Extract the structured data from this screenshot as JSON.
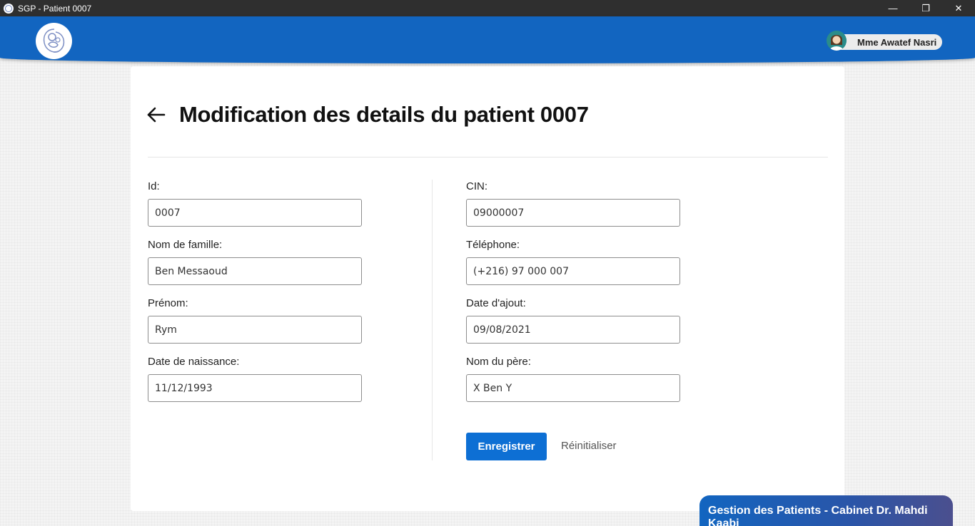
{
  "window": {
    "title": "SGP - Patient 0007",
    "minimize_glyph": "—",
    "restore_glyph": "❐",
    "close_glyph": "✕"
  },
  "header": {
    "user_name": "Mme Awatef Nasri",
    "logo_icon": "mother-child-logo-icon",
    "avatar_icon": "user-avatar-icon"
  },
  "page": {
    "title": "Modification des details du patient 0007",
    "back_icon": "arrow-left-icon"
  },
  "form": {
    "left": [
      {
        "label": "Id:",
        "value": "0007"
      },
      {
        "label": "Nom de famille:",
        "value": "Ben Messaoud"
      },
      {
        "label": "Prénom:",
        "value": "Rym"
      },
      {
        "label": "Date de naissance:",
        "value": "11/12/1993"
      }
    ],
    "right": [
      {
        "label": "CIN:",
        "value": "09000007"
      },
      {
        "label": "Téléphone:",
        "value": "(+216) 97 000 007"
      },
      {
        "label": "Date d'ajout:",
        "value": "09/08/2021"
      },
      {
        "label": "Nom du père:",
        "value": "X Ben Y"
      }
    ],
    "save_label": "Enregistrer",
    "reset_label": "Réinitialiser"
  },
  "footer": {
    "text": "Gestion des Patients - Cabinet Dr. Mahdi Kaabi"
  },
  "colors": {
    "header_blue": "#1265c0",
    "button_blue": "#0d6fd4",
    "titlebar": "#2f2f2f"
  }
}
